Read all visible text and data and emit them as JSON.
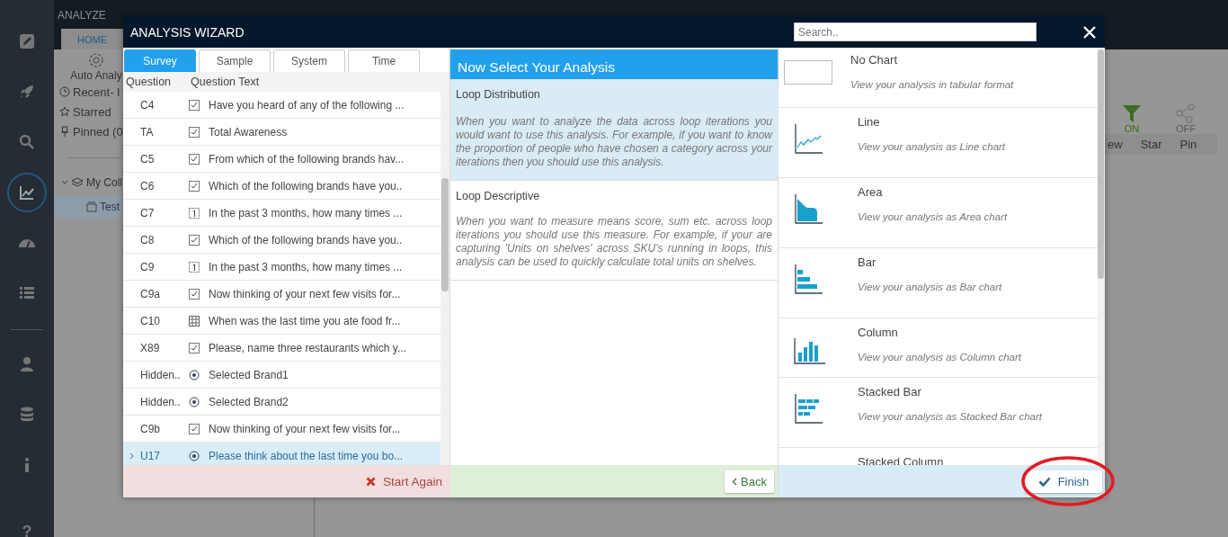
{
  "app": {
    "section": "ANALYZE",
    "home_tab": "HOME",
    "auto_analysis": "Auto Analy",
    "nav": [
      {
        "selected": false
      },
      {
        "selected": false
      },
      {
        "selected": false
      },
      {
        "selected": true
      },
      {
        "selected": false
      },
      {
        "selected": false
      },
      {
        "selected": false
      },
      {
        "selected": false
      },
      {
        "selected": false
      }
    ],
    "help": "?",
    "links": [
      {
        "kind": "recent",
        "label": "Recent- l"
      },
      {
        "kind": "starred",
        "label": "Starred"
      },
      {
        "kind": "pinned",
        "label": "Pinned (0"
      }
    ],
    "collection": {
      "label": "My Coll",
      "expanded": true,
      "children": [
        {
          "label": "Test",
          "selected": true
        }
      ]
    },
    "toolbar": {
      "toggles": [
        {
          "kind": "filter",
          "state": "ON",
          "on": true
        },
        {
          "kind": "share",
          "state": "OFF",
          "on": false
        }
      ],
      "labels": [
        "ew",
        "Star",
        "Pin"
      ]
    }
  },
  "wizard": {
    "title": "ANALYSIS WIZARD",
    "search": {
      "placeholder": "Search.."
    },
    "tabs": [
      {
        "label": "Survey",
        "selected": true
      },
      {
        "label": "Sample",
        "selected": false
      },
      {
        "label": "System",
        "selected": false
      },
      {
        "label": "Time",
        "selected": false
      }
    ],
    "columns": [
      "Question",
      "Question Text"
    ],
    "questions": [
      {
        "id": "C4",
        "kind": "checkbox",
        "text": "Have you heard of any of the following ...",
        "selected": false
      },
      {
        "id": "TA",
        "kind": "checkbox",
        "text": "Total Awareness",
        "selected": false
      },
      {
        "id": "C5",
        "kind": "checkbox",
        "text": "From which of the following brands hav...",
        "selected": false
      },
      {
        "id": "C6",
        "kind": "checkbox",
        "text": "Which of the following brands have you..",
        "selected": false
      },
      {
        "id": "C7",
        "kind": "numeric",
        "text": "In the past 3 months, how many times ...",
        "selected": false
      },
      {
        "id": "C8",
        "kind": "checkbox",
        "text": "Which of the following brands have you..",
        "selected": false
      },
      {
        "id": "C9",
        "kind": "numeric",
        "text": "In the past 3 months, how many times ...",
        "selected": false
      },
      {
        "id": "C9a",
        "kind": "checkbox",
        "text": "Now thinking of your next few visits for...",
        "selected": false
      },
      {
        "id": "C10",
        "kind": "grid",
        "text": "When was the last time you ate food fr...",
        "selected": false
      },
      {
        "id": "X89",
        "kind": "checkbox",
        "text": "Please, name three restaurants which y...",
        "selected": false
      },
      {
        "id": "Hidden..",
        "kind": "radio",
        "text": "Selected Brand1",
        "selected": false
      },
      {
        "id": "Hidden..",
        "kind": "radio",
        "text": "Selected Brand2",
        "selected": false
      },
      {
        "id": "C9b",
        "kind": "checkbox",
        "text": "Now thinking of your next few visits for...",
        "selected": false
      },
      {
        "id": "U17",
        "kind": "radio",
        "text": "Please think about the last time you bo...",
        "selected": true
      }
    ],
    "start_again": "Start Again",
    "analysis_heading": "Now Select Your Analysis",
    "analyses": [
      {
        "title": "Loop Distribution",
        "description": "When you want to analyze the data across loop iterations you would want to use this analysis. For example, if you want to know the proportion of people who have chosen a category across your iterations then you should use this analysis.",
        "selected": true
      },
      {
        "title": "Loop Descriptive",
        "description": "When you want to measure means score, sum etc. across loop iterations you should use this measure. For example, if your are capturing 'Units on shelves' across SKU's running in loops, this analysis can be used to quickly calculate total units on shelves.",
        "selected": false
      }
    ],
    "back": "Back",
    "charts": [
      {
        "kind": "table",
        "title": "No Chart",
        "description": "View your analysis in tabular format"
      },
      {
        "kind": "line",
        "title": "Line",
        "description": "View your analysis as Line chart"
      },
      {
        "kind": "area",
        "title": "Area",
        "description": "View your analysis as Area chart"
      },
      {
        "kind": "bar",
        "title": "Bar",
        "description": "View your analysis as Bar chart"
      },
      {
        "kind": "column",
        "title": "Column",
        "description": "View your analysis as Column chart"
      },
      {
        "kind": "stacked-bar",
        "title": "Stacked Bar",
        "description": "View your analysis as Stacked Bar chart"
      },
      {
        "kind": "stacked-column",
        "title": "Stacked Column"
      }
    ],
    "finish": "Finish"
  }
}
